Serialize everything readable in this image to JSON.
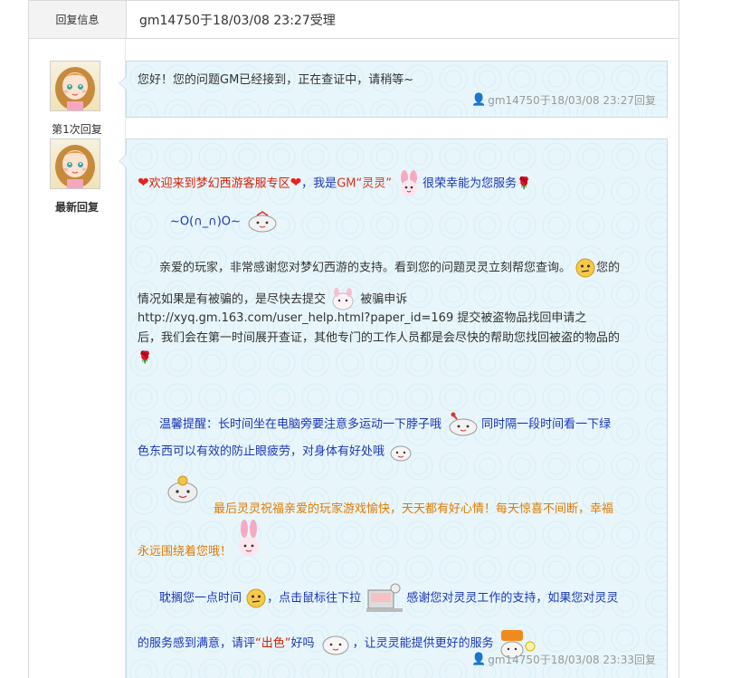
{
  "header": {
    "label": "回复信息",
    "value": "gm14750于18/03/08 23:27受理"
  },
  "replies": [
    {
      "avatar_label": "第1次回复",
      "text": "您好！您的问题GM已经接到，正在查证中，请稍等~",
      "meta": "gm14750于18/03/08 23:27回复"
    },
    {
      "avatar_label": "最新回复",
      "line1_a": "欢迎来到梦幻西游客服专区",
      "line1_b": "，我是",
      "line1_c": "GM“灵灵”",
      "line1_d": "很荣幸能为您服务",
      "line2": "~O(∩_∩)O~",
      "p1_l1": "亲爱的玩家，非常感谢您对梦幻西游的支持。看到您的问题灵灵立刻帮您查询。",
      "p1_l1_end": "您的",
      "p1_l2_a": "情况如果是有被骗的，是尽快去提交",
      "p1_l2_b": "被骗申诉",
      "p1_l3": "http://xyq.gm.163.com/user_help.html?paper_id=169 提交被盗物品找回申请之",
      "p1_l4": "后，我们会在第一时间展开查证，其他专门的工作人员都是会尽快的帮助您找回被盗的物品的",
      "p2_l1_a": "温馨提醒：长时间坐在电脑旁要注意多运动一下脖子哦",
      "p2_l1_b": "同时隔一段时间看一下绿",
      "p2_l2": "色东西可以有效的防止眼疲劳，对身体有好处哦",
      "p3_l1": "最后灵灵祝福亲爱的玩家游戏愉快，天天都有好心情！每天惊喜不间断，幸福",
      "p3_l2": "永远围绕着您哦！",
      "p4_l1_a": "耽搁您一点时间",
      "p4_l1_b": "，点击鼠标往下拉",
      "p4_l1_c": "感谢您对灵灵工作的支持，如果您对灵灵",
      "p4_l2_a": "的服务感到满意，请评",
      "p4_l2_b": "“出色”",
      "p4_l2_c": "好吗",
      "p4_l2_d": "，让灵灵能提供更好的服务",
      "meta": "gm14750于18/03/08 23:33回复"
    }
  ],
  "icons": {
    "heart": "heart-icon",
    "rose": "rose-icon",
    "user": "user-icon"
  }
}
